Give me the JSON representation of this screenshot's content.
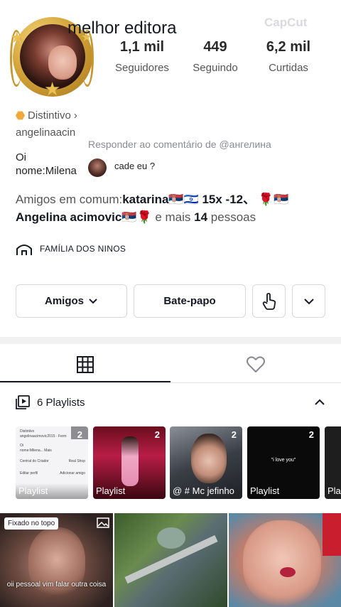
{
  "profile": {
    "display_name": "melhor editora",
    "stats": [
      {
        "value": "1,1 mil",
        "label": "Seguidores"
      },
      {
        "value": "449",
        "label": "Seguindo"
      },
      {
        "value": "6,2 mil",
        "label": "Curtidas"
      }
    ],
    "watermark": "CapCut",
    "badge_label": "Distintivo",
    "username": "angelinaacin",
    "bio_line1": "Oi",
    "bio_line2": "nome:Milena"
  },
  "reply_overlay": {
    "header": "Responder ao comentário de @ангелина",
    "comment": "cade eu ?"
  },
  "mutual": {
    "prefix": "Amigos em comum:",
    "name1": "katarina",
    "flags1": "🇷🇸🇮🇱",
    "name1_suffix": " 15x -12、",
    "rose": "🌹",
    "flag_rs": "🇷🇸",
    "name2": "Angelina acimovic",
    "middle": " e mais ",
    "count": "14",
    "suffix": " pessoas"
  },
  "family": {
    "label": "FAMÍLIA DOS NINOS"
  },
  "actions": {
    "friends_label": "Amigos",
    "chat_label": "Bate-papo"
  },
  "tabs": [
    {
      "name": "videos",
      "icon": "grid-icon",
      "active": true
    },
    {
      "name": "liked",
      "icon": "heart-icon",
      "active": false
    }
  ],
  "playlists": {
    "header": "6 Playlists",
    "items": [
      {
        "label": "Playlist",
        "count": "2"
      },
      {
        "label": "Playlist",
        "count": "2"
      },
      {
        "label": "@ # Mc jefinho",
        "count": "2"
      },
      {
        "label": "Playlist",
        "count": "2"
      },
      {
        "label": "Pla",
        "count": ""
      }
    ],
    "card1_lines": [
      "Distintivo",
      "angelinaacimovic2015 · Ferm",
      "Oi",
      "nome:Milena... Mais",
      "Central do Criador",
      "Real Shop",
      "Editar perfil",
      "Adicionar amigo"
    ],
    "card4_text": "\"i love you\""
  },
  "videos": [
    {
      "pin": "Fixado no topo",
      "caption": "oii pessoal vim falar outra coisa"
    },
    {
      "pin": "",
      "caption": ""
    },
    {
      "pin": "",
      "caption": ""
    }
  ],
  "colors": {
    "accent_gold": "#d4a53a",
    "text_primary": "#161823",
    "text_secondary": "#555555"
  }
}
